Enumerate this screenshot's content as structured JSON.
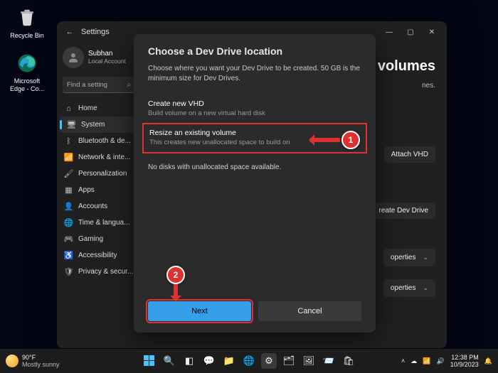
{
  "desktop": {
    "icons": [
      {
        "label": "Recycle Bin"
      },
      {
        "label": "Microsoft Edge - Co..."
      }
    ]
  },
  "window": {
    "title": "Settings",
    "account_name": "Subhan",
    "account_type": "Local Account",
    "search_placeholder": "Find a setting",
    "nav": [
      {
        "icon": "home",
        "label": "Home"
      },
      {
        "icon": "system",
        "label": "System"
      },
      {
        "icon": "bt",
        "label": "Bluetooth & de..."
      },
      {
        "icon": "net",
        "label": "Network & inte..."
      },
      {
        "icon": "pers",
        "label": "Personalization"
      },
      {
        "icon": "apps",
        "label": "Apps"
      },
      {
        "icon": "acct",
        "label": "Accounts"
      },
      {
        "icon": "time",
        "label": "Time & langua..."
      },
      {
        "icon": "game",
        "label": "Gaming"
      },
      {
        "icon": "acc",
        "label": "Accessibility"
      },
      {
        "icon": "priv",
        "label": "Privacy & secur..."
      }
    ],
    "nav_selected_index": 1
  },
  "content": {
    "heading_tail": "volumes",
    "sub_tail": "nes.",
    "attach_btn": "Attach VHD",
    "create_btn": "reate Dev Drive",
    "prop1": "operties",
    "prop2": "operties"
  },
  "dialog": {
    "title": "Choose a Dev Drive location",
    "desc": "Choose where you want your Dev Drive to be created. 50 GB is the minimum size for Dev Drives.",
    "opt1_title": "Create new VHD",
    "opt1_sub": "Build volume on a new virtual hard disk",
    "opt2_title": "Resize an existing volume",
    "opt2_sub": "This creates new unallocated space to build on",
    "msg": "No disks with unallocated space available.",
    "next": "Next",
    "cancel": "Cancel"
  },
  "annotations": {
    "b1": "1",
    "b2": "2"
  },
  "taskbar": {
    "temp": "90°F",
    "cond": "Mostly sunny",
    "time": "12:38 PM",
    "date": "10/9/2023"
  }
}
